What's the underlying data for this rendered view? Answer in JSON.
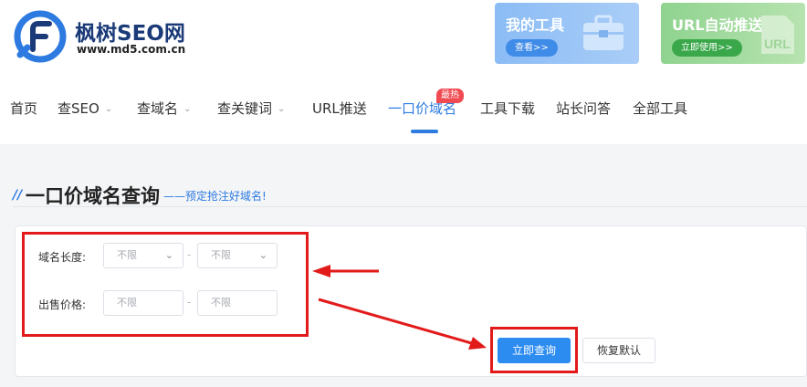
{
  "site": {
    "brand": "枫树SEO网",
    "domain": "www.md5.com.cn"
  },
  "cards": {
    "tools": {
      "title": "我的工具",
      "button": "查看>>"
    },
    "url": {
      "title": "URL自动推送",
      "button": "立即使用>>"
    }
  },
  "nav": {
    "items": [
      "首页",
      "查SEO",
      "查域名",
      "查关键词",
      "URL推送",
      "一口价域名",
      "工具下载",
      "站长问答",
      "全部工具"
    ],
    "hot_badge": "最热"
  },
  "section": {
    "title": "一口价域名查询",
    "subtitle": "——预定抢注好域名!"
  },
  "filters": {
    "length_label": "域名长度:",
    "price_label": "出售价格:",
    "length_min": "不限",
    "length_max": "不限",
    "price_min_placeholder": "不限",
    "price_max_placeholder": "不限",
    "separator": "-"
  },
  "actions": {
    "query": "立即查询",
    "reset": "恢复默认"
  },
  "colors": {
    "accent": "#2d7be0",
    "annotation": "#e31a1a",
    "hot": "#f04b52"
  },
  "icons": [
    "logo-f-icon",
    "toolbox-icon",
    "url-icon",
    "chevron-down-icon"
  ]
}
